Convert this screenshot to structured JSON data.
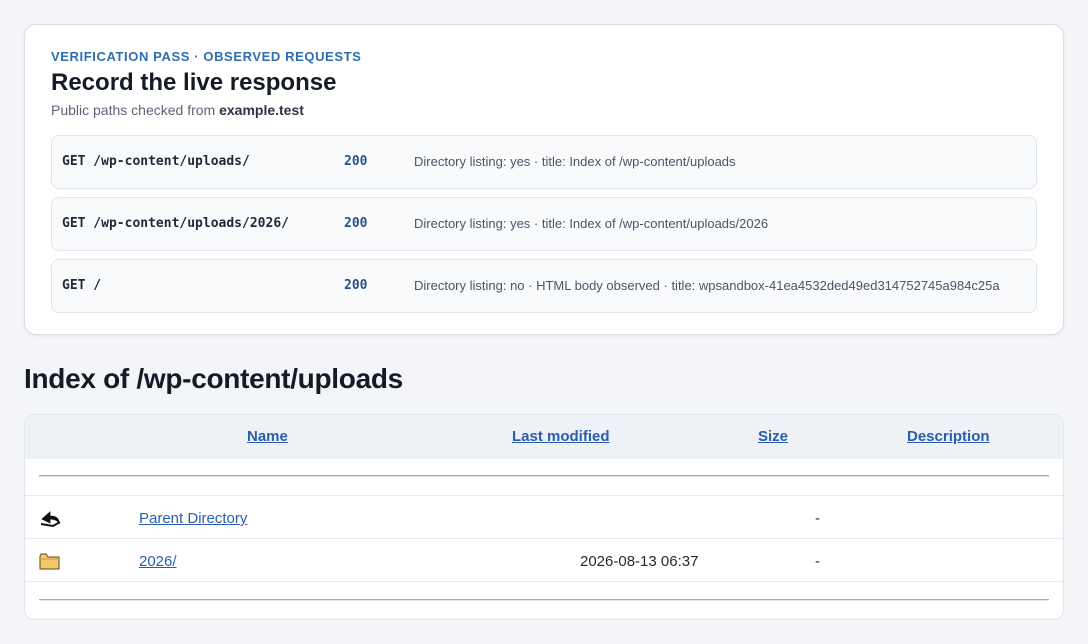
{
  "verification": {
    "eyebrow": "VERIFICATION PASS · OBSERVED REQUESTS",
    "title": "Record the live response",
    "subtitle_prefix": "Public paths checked from",
    "host": "example.test",
    "requests": [
      {
        "method_path": "GET /wp-content/uploads/",
        "status": "200",
        "note": "Directory listing: yes · title: Index of /wp-content/uploads"
      },
      {
        "method_path": "GET /wp-content/uploads/2026/",
        "status": "200",
        "note": "Directory listing: yes · title: Index of /wp-content/uploads/2026"
      },
      {
        "method_path": "GET /",
        "status": "200",
        "note": "Directory listing: no · HTML body observed · title: wpsandbox-41ea4532ded49ed314752745a984c25a"
      }
    ]
  },
  "index": {
    "title": "Index of /wp-content/uploads",
    "columns": {
      "name": "Name",
      "modified": "Last modified",
      "size": "Size",
      "description": "Description"
    },
    "rows": [
      {
        "icon": "back-arrow-icon",
        "name": "Parent Directory",
        "modified": "",
        "size": "-",
        "description": ""
      },
      {
        "icon": "folder-icon",
        "name": "2026/",
        "modified": "2026-08-13 06:37",
        "size": "-",
        "description": ""
      }
    ]
  },
  "colors": {
    "accent": "#2f6db3",
    "link": "#2a5db0",
    "status": "#2b4f8a",
    "background": "#f3f5f8"
  }
}
